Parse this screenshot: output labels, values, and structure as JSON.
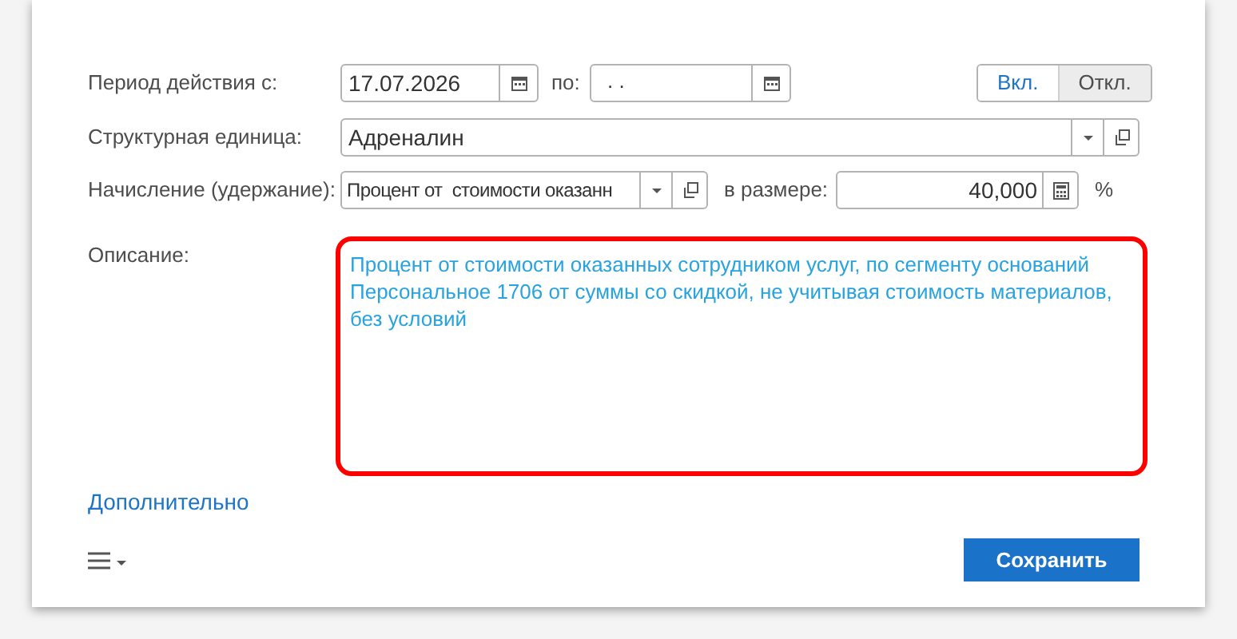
{
  "period": {
    "label": "Период действия с:",
    "from": "17.07.2026",
    "to_label": "по:",
    "to": ". .",
    "toggle": [
      {
        "label": "Вкл.",
        "selected": false
      },
      {
        "label": "Откл.",
        "selected": true
      }
    ]
  },
  "unit": {
    "label": "Структурная единица:",
    "value": "Адреналин"
  },
  "accrual": {
    "label": "Начисление (удержание):",
    "value": "Процент от  стоимости оказанн",
    "amount_label": "в размере:",
    "amount": "40,000",
    "unit": "%"
  },
  "description": {
    "label": "Описание:",
    "value": "Процент от стоимости оказанных сотрудником услуг, по сегменту оснований Персональное 1706 от суммы со скидкой, не учитывая стоимость материалов, без условий",
    "highlighted": true
  },
  "more_link": "Дополнительно",
  "save_button": "Сохранить"
}
